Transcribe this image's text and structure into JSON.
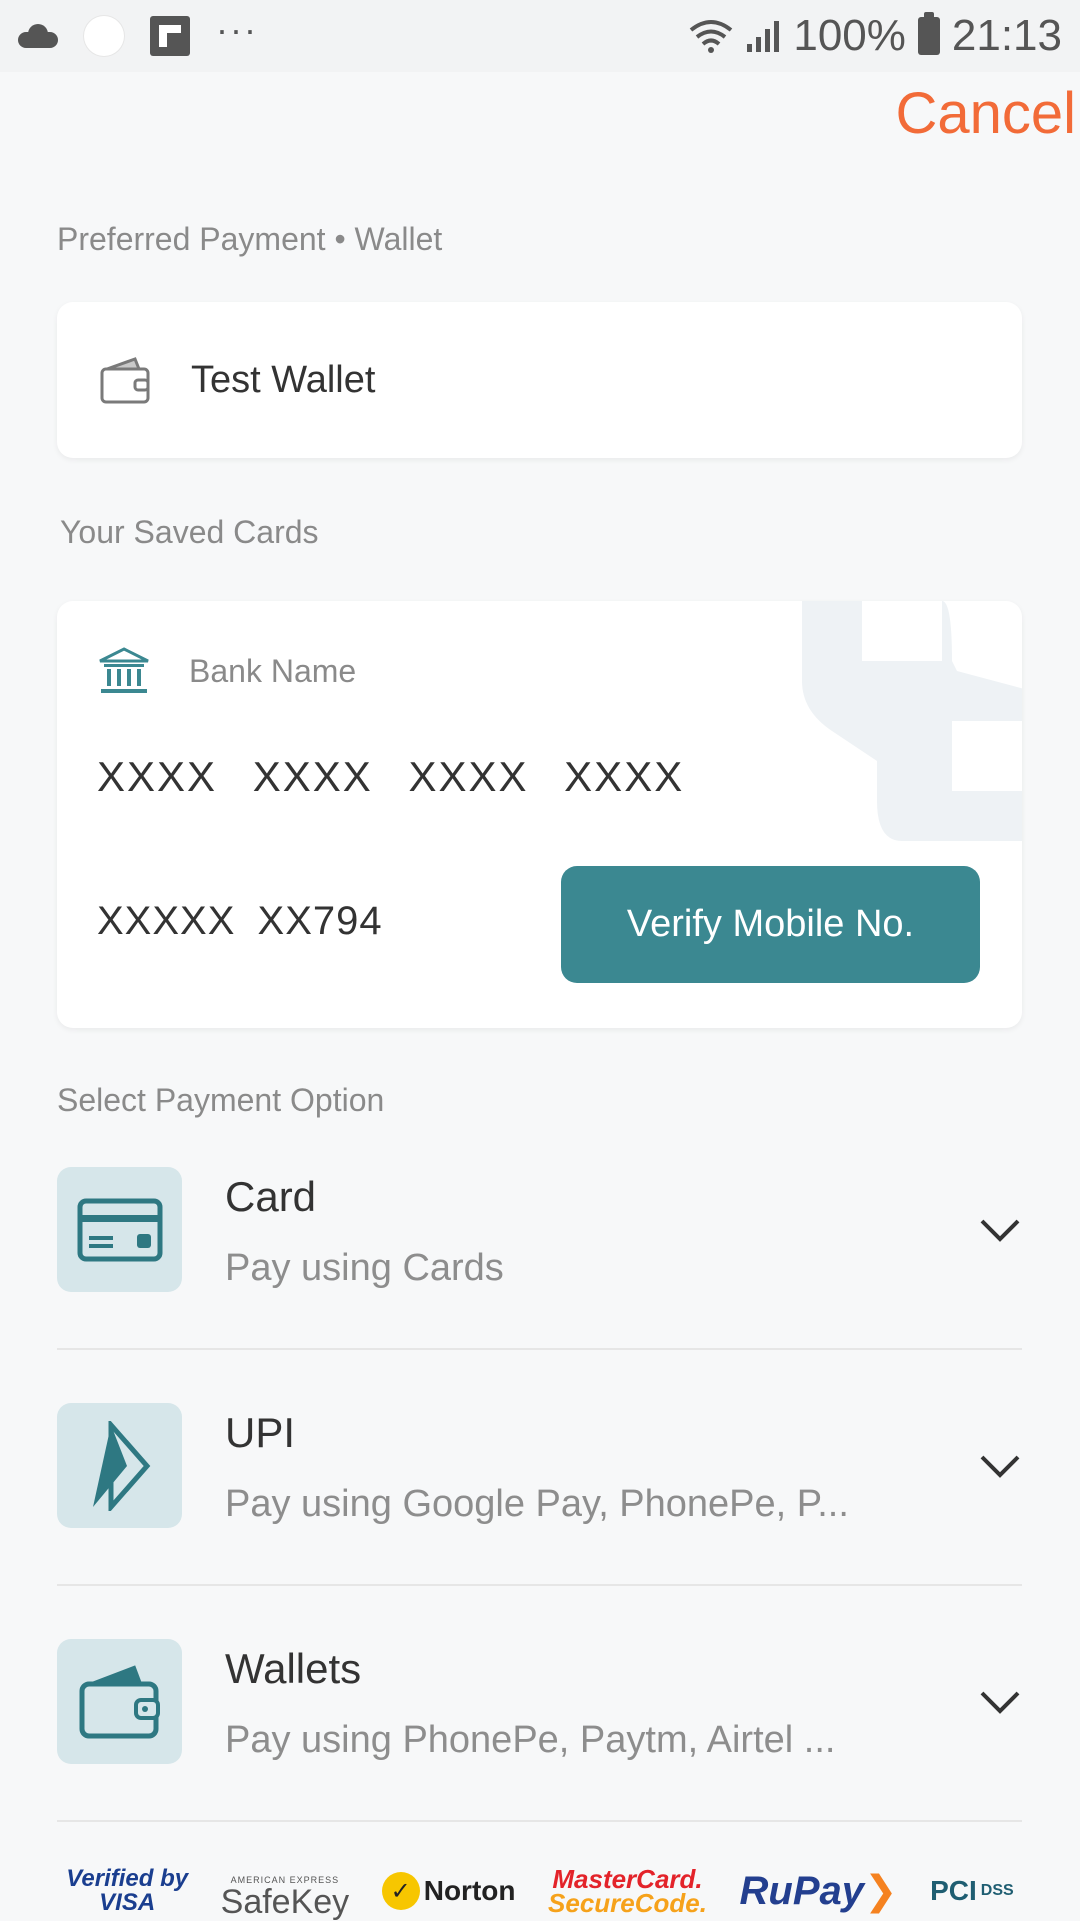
{
  "status_bar": {
    "battery": "100%",
    "time": "21:13",
    "overflow": "···"
  },
  "header": {
    "cancel_label": "Cancel"
  },
  "preferred": {
    "label": "Preferred Payment • Wallet",
    "wallet_name": "Test Wallet",
    "icon": "wallet-icon"
  },
  "saved_cards": {
    "label": "Your Saved Cards",
    "bank_name": "Bank Name",
    "card_number": "XXXX XXXX XXXX XXXX",
    "mobile": "XXXXX XX794",
    "verify_label": "Verify Mobile No."
  },
  "payment_options": {
    "label": "Select Payment Option",
    "items": [
      {
        "title": "Card",
        "subtitle": "Pay using Cards",
        "icon": "credit-card-icon"
      },
      {
        "title": "UPI",
        "subtitle": "Pay using Google Pay, PhonePe, P...",
        "icon": "upi-icon"
      },
      {
        "title": "Wallets",
        "subtitle": "Pay using PhonePe, Paytm, Airtel ...",
        "icon": "wallet-icon"
      }
    ]
  },
  "footer_logos": {
    "visa_line1": "Verified by",
    "visa_line2": "VISA",
    "safekey_top": "AMERICAN EXPRESS",
    "safekey": "SafeKey",
    "norton": "Norton",
    "mastercard_line1": "MasterCard.",
    "mastercard_line2": "SecureCode.",
    "rupay": "RuPay",
    "pci": "PCI",
    "dss": "DSS"
  },
  "colors": {
    "accent": "#f26b38",
    "teal": "#3b8891",
    "icon_bg": "#d6e6ea"
  }
}
